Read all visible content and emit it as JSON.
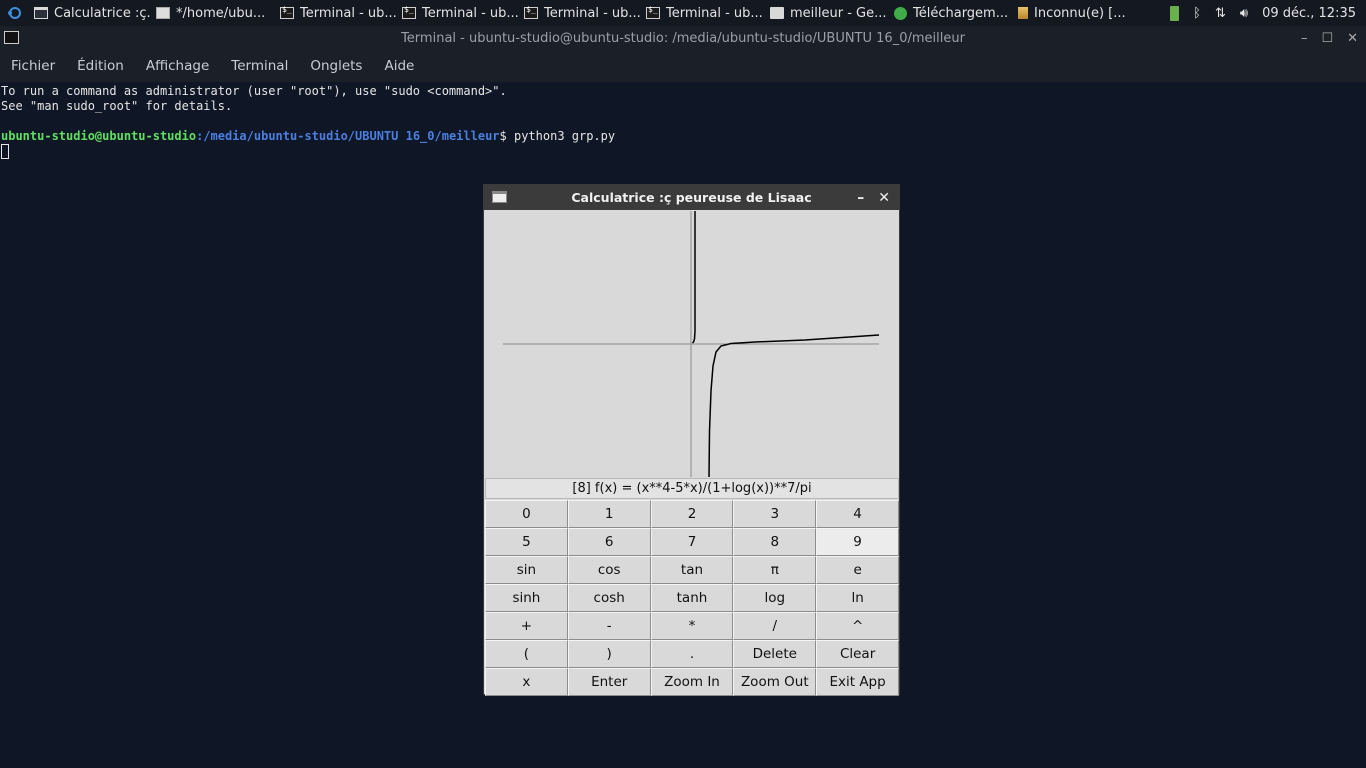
{
  "taskbar": {
    "tasks": [
      {
        "label": "Calculatrice :ç...",
        "icon": "window-icon"
      },
      {
        "label": "*/home/ubu...",
        "icon": "text-editor-icon"
      },
      {
        "label": "Terminal - ub...",
        "icon": "terminal-icon"
      },
      {
        "label": "Terminal - ub...",
        "icon": "terminal-icon"
      },
      {
        "label": "Terminal - ub...",
        "icon": "terminal-icon"
      },
      {
        "label": "Terminal - ub...",
        "icon": "terminal-icon"
      },
      {
        "label": "meilleur - Ge...",
        "icon": "folder-icon"
      },
      {
        "label": "Téléchargem...",
        "icon": "download-icon"
      },
      {
        "label": "Inconnu(e) [...",
        "icon": "music-icon"
      }
    ],
    "clock": "09 déc., 12:35"
  },
  "terminal": {
    "title": "Terminal - ubuntu-studio@ubuntu-studio: /media/ubuntu-studio/UBUNTU 16_0/meilleur",
    "menu": [
      "Fichier",
      "Édition",
      "Affichage",
      "Terminal",
      "Onglets",
      "Aide"
    ],
    "lines": [
      "To run a command as administrator (user \"root\"), use \"sudo <command>\".",
      "See \"man sudo_root\" for details."
    ],
    "prompt_user": "ubuntu-studio@ubuntu-studio",
    "prompt_path": ":/media/ubuntu-studio/UBUNTU 16_0/meilleur",
    "prompt_cmd": "$ python3 grp.py"
  },
  "calculator": {
    "title": "Calculatrice :ç peureuse de Lisaac",
    "formula": "[8] f(x) = (x**4-5*x)/(1+log(x))**7/pi",
    "buttons": [
      [
        "0",
        "1",
        "2",
        "3",
        "4"
      ],
      [
        "5",
        "6",
        "7",
        "8",
        "9"
      ],
      [
        "sin",
        "cos",
        "tan",
        "π",
        "e"
      ],
      [
        "sinh",
        "cosh",
        "tanh",
        "log",
        "ln"
      ],
      [
        "+",
        "-",
        "*",
        "/",
        "^"
      ],
      [
        "(",
        ")",
        ".",
        "Delete",
        "Clear"
      ],
      [
        "x",
        "Enter",
        "Zoom In",
        "Zoom Out",
        "Exit App"
      ]
    ],
    "active_button": "9"
  }
}
